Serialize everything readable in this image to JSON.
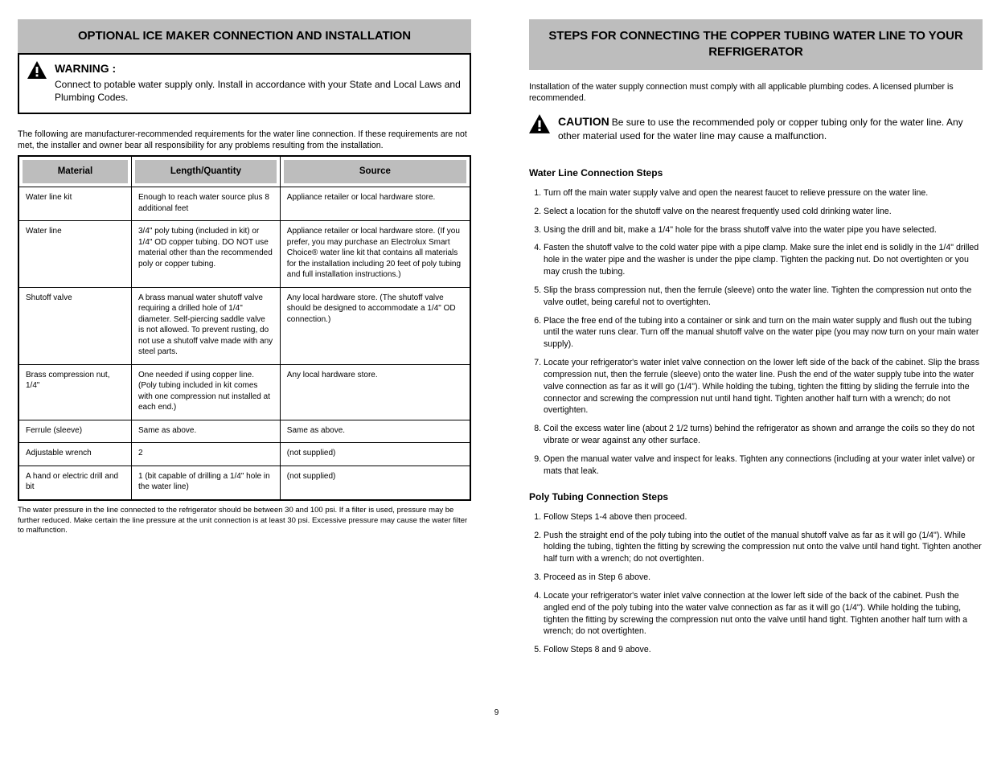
{
  "left": {
    "banner": "OPTIONAL ICE MAKER CONNECTION AND INSTALLATION",
    "warning_label": "WARNING :",
    "warning_text": "Connect to potable water supply only. Install in accordance with your State and Local Laws and Plumbing Codes.",
    "intro": "The following are manufacturer-recommended requirements for the water line connection. If these requirements are not met, the installer and owner bear all responsibility for any problems resulting from the installation.",
    "table_headers": [
      "Material",
      "Length/Quantity",
      "Source"
    ],
    "rows": [
      {
        "material": "Water line kit",
        "lq": "Enough to reach water source plus 8 additional feet",
        "source": "Appliance retailer or local hardware store."
      },
      {
        "material": "Water line",
        "lq": "3/4\" poly tubing (included in kit) or 1/4\" OD copper tubing. DO NOT use material other than the recommended poly or copper tubing.",
        "source": "Appliance retailer or local hardware store. (If you prefer, you may purchase an Electrolux Smart Choice® water line kit that contains all materials for the installation including 20 feet of poly tubing and full installation instructions.)"
      },
      {
        "material": "Shutoff valve",
        "lq": "A brass manual water shutoff valve requiring a drilled hole of 1/4\" diameter. Self-piercing saddle valve is not allowed. To prevent rusting, do not use a shutoff valve made with any steel parts.",
        "source": "Any local hardware store. (The shutoff valve should be designed to accommodate a 1/4\" OD connection.)"
      },
      {
        "material": "Brass compression nut, 1/4\"",
        "lq": "One needed if using copper line. (Poly tubing included in kit comes with one compression nut installed at each end.)",
        "source": "Any local hardware store."
      },
      {
        "material": "Ferrule (sleeve)",
        "lq": "Same as above.",
        "source": "Same as above."
      },
      {
        "material": "Adjustable wrench",
        "lq": "2",
        "source": "(not supplied)"
      },
      {
        "material": "A hand or electric drill and bit",
        "lq": "1 (bit capable of drilling a 1/4\" hole in the water line)",
        "source": "(not supplied)"
      }
    ],
    "footnote": "The water pressure in the line connected to the refrigerator should be between 30 and 100 psi. If a filter is used, pressure may be further reduced. Make certain the line pressure at the unit connection is at least 30 psi. Excessive pressure may cause the water filter to malfunction."
  },
  "right": {
    "banner": "STEPS FOR CONNECTING THE COPPER TUBING WATER LINE TO YOUR REFRIGERATOR",
    "intro": "Installation of the water supply connection must comply with all applicable plumbing codes. A licensed plumber is recommended.",
    "warning_label": "CAUTION",
    "warning_text": "Be sure to use the recommended poly or copper tubing only for the water line. Any other material used for the water line may cause a malfunction.",
    "steps_heading": "Water Line Connection Steps",
    "steps": [
      "Turn off the main water supply valve and open the nearest faucet to relieve pressure on the water line.",
      "Select a location for the shutoff valve on the nearest frequently used cold drinking water line.",
      "Using the drill and bit, make a 1/4\" hole for the brass shutoff valve into the water pipe you have selected.",
      "Fasten the shutoff valve to the cold water pipe with a pipe clamp. Make sure the inlet end is solidly in the 1/4\" drilled hole in the water pipe and the washer is under the pipe clamp. Tighten the packing nut. Do not overtighten or you may crush the tubing.",
      "Slip the brass compression nut, then the ferrule (sleeve) onto the water line. Tighten the compression nut onto the valve outlet, being careful not to overtighten.",
      "Place the free end of the tubing into a container or sink and turn on the main water supply and flush out the tubing until the water runs clear. Turn off the manual shutoff valve on the water pipe (you may now turn on your main water supply).",
      "Locate your refrigerator's water inlet valve connection on the lower left side of the back of the cabinet. Slip the brass compression nut, then the ferrule (sleeve) onto the water line. Push the end of the water supply tube into the water valve connection as far as it will go (1/4\"). While holding the tubing, tighten the fitting by sliding the ferrule into the connector and screwing the compression nut until hand tight. Tighten another half turn with a wrench; do not overtighten.",
      "Coil the excess water line (about 2 1/2 turns) behind the refrigerator as shown and arrange the coils so they do not vibrate or wear against any other surface.",
      "Open the manual water valve and inspect for leaks. Tighten any connections (including at your water inlet valve) or mats that leak."
    ],
    "steps_heading2": "Poly Tubing Connection Steps",
    "steps2": [
      "Follow Steps 1-4 above then proceed.",
      "Push the straight end of the poly tubing into the outlet of the manual shutoff valve as far as it will go (1/4\"). While holding the tubing, tighten the fitting by screwing the compression nut onto the valve until hand tight. Tighten another half turn with a wrench; do not overtighten.",
      "Proceed as in Step 6 above.",
      "Locate your refrigerator's water inlet valve connection at the lower left side of the back of the cabinet. Push the angled end of the poly tubing into the water valve connection as far as it will go (1/4\"). While holding the tubing, tighten the fitting by screwing the compression nut onto the valve until hand tight. Tighten another half turn with a wrench; do not overtighten.",
      "Follow Steps 8 and 9 above."
    ]
  },
  "page_number": "9"
}
